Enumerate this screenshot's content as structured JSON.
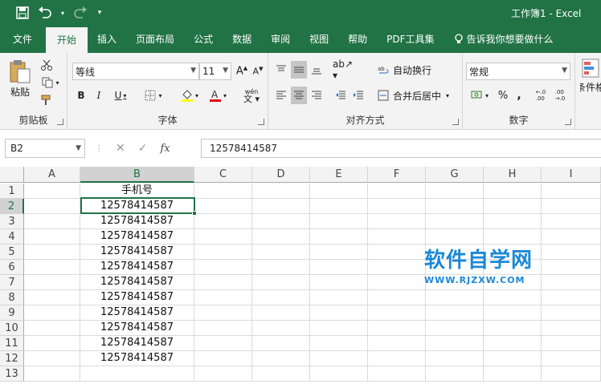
{
  "title": "工作簿1  -  Excel",
  "tabs": [
    "文件",
    "开始",
    "插入",
    "页面布局",
    "公式",
    "数据",
    "审阅",
    "视图",
    "帮助",
    "PDF工具集"
  ],
  "tell_me": "告诉我你想要做什么",
  "clipboard": {
    "label": "剪贴板",
    "paste": "粘贴"
  },
  "font": {
    "label": "字体",
    "name": "等线",
    "size": "11",
    "phonetic": "wén"
  },
  "alignment": {
    "label": "对齐方式",
    "wrap": "自动换行",
    "merge": "合并后居中"
  },
  "number": {
    "label": "数字",
    "format": "常规"
  },
  "styles": {
    "cond": "条件格"
  },
  "formula_bar": {
    "name_box": "B2",
    "fx": "fx",
    "value": "12578414587"
  },
  "columns": [
    "A",
    "B",
    "C",
    "D",
    "E",
    "F",
    "G",
    "H",
    "I"
  ],
  "rows": [
    "1",
    "2",
    "3",
    "4",
    "5",
    "6",
    "7",
    "8",
    "9",
    "10",
    "11",
    "12",
    "13"
  ],
  "cells_b": [
    "手机号",
    "12578414587",
    "12578414587",
    "12578414587",
    "12578414587",
    "12578414587",
    "12578414587",
    "12578414587",
    "12578414587",
    "12578414587",
    "12578414587",
    "12578414587",
    ""
  ],
  "watermark": {
    "cn": "软件自学网",
    "en": "WWW.RJZXW.COM"
  },
  "colors": {
    "accent": "#217346",
    "watermark": "#1b88d6"
  }
}
